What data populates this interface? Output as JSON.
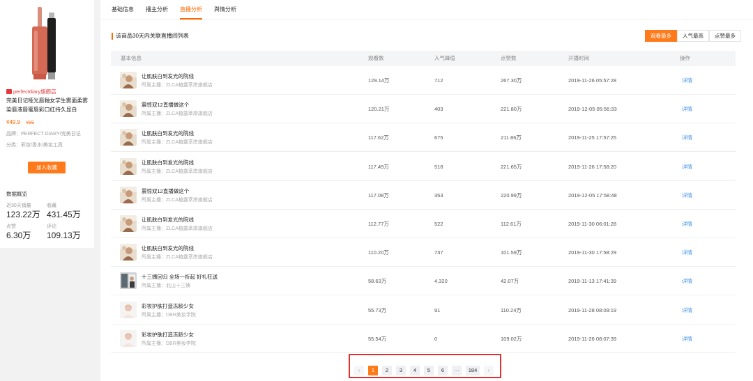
{
  "product": {
    "shop": "perfectdiary旗舰店",
    "title": "完美日记哑光唇釉女学生雾面柔雾染唇液唇蜜唇彩口红持久显白",
    "price": "¥49.9",
    "original_price": "¥89",
    "brand": "品牌：PERFECT DIARY/完美日记",
    "category": "分类：彩妆/香水/美妆工具",
    "fav_button": "加入收藏",
    "stats_title": "数据概览",
    "stats": [
      {
        "label": "近30天销量",
        "value": "123.22万"
      },
      {
        "label": "收藏",
        "value": "431.45万"
      },
      {
        "label": "点赞",
        "value": "6.30万"
      },
      {
        "label": "评论",
        "value": "109.13万"
      }
    ]
  },
  "tabs": [
    {
      "label": "基础信息",
      "active": false
    },
    {
      "label": "播主分析",
      "active": false
    },
    {
      "label": "直播分析",
      "active": true
    },
    {
      "label": "舆情分析",
      "active": false
    }
  ],
  "section_title": "该商品30天内关联直播间列表",
  "sort_buttons": [
    {
      "label": "观看最多",
      "active": true
    },
    {
      "label": "人气最高",
      "active": false
    },
    {
      "label": "点赞最多",
      "active": false
    }
  ],
  "columns": {
    "info": "基本信息",
    "views": "观看数",
    "peak": "人气峰值",
    "likes": "点赞数",
    "start": "开播时间",
    "op": "操作"
  },
  "rows": [
    {
      "title": "让肌肤白到发光的院线",
      "anchor": "所属主播：ZLCA植露萃岸旗舰店",
      "views": "129.14万",
      "peak": "712",
      "likes": "267.30万",
      "start": "2019-11-26 05:57:28",
      "op": "详情",
      "thumb": "a"
    },
    {
      "title": "震惊双12直播做这个",
      "anchor": "所属主播：ZLCA植露萃岸旗舰店",
      "views": "120.21万",
      "peak": "403",
      "likes": "221.80万",
      "start": "2019-12-05 05:56:33",
      "op": "详情",
      "thumb": "a"
    },
    {
      "title": "让肌肤白到发光的院线",
      "anchor": "所属主播：ZLCA植露萃岸旗舰店",
      "views": "117.62万",
      "peak": "675",
      "likes": "211.86万",
      "start": "2019-11-25 17:57:25",
      "op": "详情",
      "thumb": "a"
    },
    {
      "title": "让肌肤白到发光的院线",
      "anchor": "所属主播：ZLCA植露萃岸旗舰店",
      "views": "117.49万",
      "peak": "518",
      "likes": "221.65万",
      "start": "2019-11-26 17:58:20",
      "op": "详情",
      "thumb": "a"
    },
    {
      "title": "震惊双12直播做这个",
      "anchor": "所属主播：ZLCA植露萃岸旗舰店",
      "views": "117.08万",
      "peak": "353",
      "likes": "220.99万",
      "start": "2019-12-05 17:58:48",
      "op": "详情",
      "thumb": "a"
    },
    {
      "title": "让肌肤白到发光的院线",
      "anchor": "所属主播：ZLCA植露萃岸旗舰店",
      "views": "112.77万",
      "peak": "522",
      "likes": "112.61万",
      "start": "2019-11-30 06:01:28",
      "op": "详情",
      "thumb": "a"
    },
    {
      "title": "让肌肤白到发光的院线",
      "anchor": "所属主播：ZLCA植露萃岸旗舰店",
      "views": "110.20万",
      "peak": "737",
      "likes": "101.59万",
      "start": "2019-11-30 17:58:29",
      "op": "详情",
      "thumb": "a"
    },
    {
      "title": "十三姨回归 全场一折起 好礼狂送",
      "anchor": "所属主播：北山十三姨",
      "views": "58.63万",
      "peak": "4,320",
      "likes": "42.07万",
      "start": "2019-11-13 17:41:39",
      "op": "详情",
      "thumb": "b"
    },
    {
      "title": "彩妆护肤打造冻龄少女",
      "anchor": "所属主播：DBR美妆学院",
      "views": "55.73万",
      "peak": "91",
      "likes": "110.24万",
      "start": "2019-11-28 08:09:19",
      "op": "详情",
      "thumb": "c"
    },
    {
      "title": "彩妆护肤打造冻龄少女",
      "anchor": "所属主播：DBR美妆学院",
      "views": "55.54万",
      "peak": "0",
      "likes": "109.02万",
      "start": "2019-11-26 08:07:39",
      "op": "详情",
      "thumb": "c"
    }
  ],
  "pagination": {
    "prev": "‹",
    "pages": [
      "1",
      "2",
      "3",
      "4",
      "5",
      "6",
      "···",
      "184"
    ],
    "current": "1",
    "next": "›"
  },
  "colors": {
    "accent": "#ff7a1a",
    "link": "#3a8ee6",
    "highlight_box": "#e03131"
  }
}
